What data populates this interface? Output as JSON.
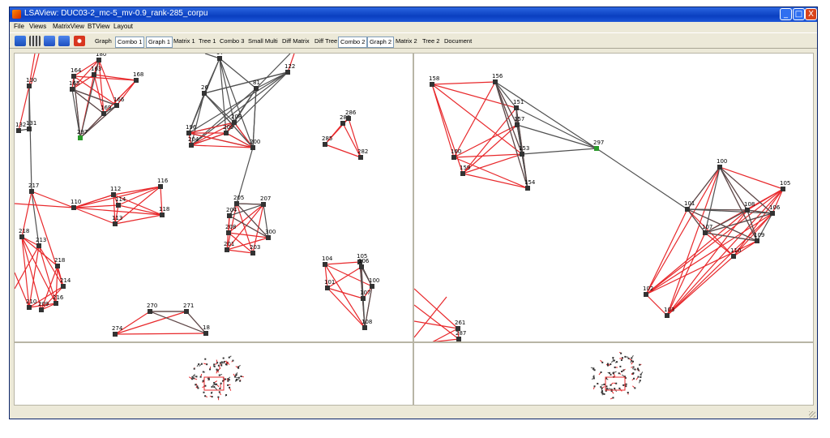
{
  "window": {
    "title": "LSAView: DUC03-2_mc-5_mv-0.9_rank-285_corpu",
    "controls": {
      "minimize": "_",
      "maximize": "□",
      "close": "X"
    }
  },
  "menu": [
    "File",
    "Views",
    "MatrixView",
    "BTView",
    "Layout"
  ],
  "toolbar": {
    "icons": [
      "open-folder-icon",
      "grid-icon",
      "save-icon",
      "save-as-icon",
      "power-icon"
    ],
    "tabs": [
      "Graph",
      "Combo 1",
      "Graph 1",
      "Matrix 1",
      "Tree 1",
      "Combo 3",
      "Small Multi",
      "Diff Matrix",
      "Diff Tree",
      "Combo 2",
      "Graph 2",
      "Matrix 2",
      "Tree 2",
      "Document"
    ],
    "selected_tabs": [
      "Combo 1",
      "Graph 1",
      "Combo 2",
      "Graph 2"
    ]
  },
  "colors": {
    "edge_red": "#e8282b",
    "edge_gray": "#505050",
    "node": "#333333",
    "node_highlight": "#2a9a2a"
  },
  "graph_left": {
    "node_labels": [
      "180",
      "164",
      "163",
      "168",
      "165",
      "166",
      "169",
      "297",
      "130",
      "132",
      "131",
      "217",
      "110",
      "112",
      "114",
      "113",
      "116",
      "118",
      "218",
      "213",
      "218",
      "214",
      "216",
      "210",
      "209",
      "97",
      "26",
      "81",
      "122",
      "208",
      "196",
      "209",
      "204",
      "200",
      "205",
      "207",
      "204",
      "208",
      "201",
      "203",
      "300",
      "283",
      "286",
      "285",
      "282",
      "105",
      "106",
      "104",
      "101",
      "100",
      "107",
      "108",
      "270",
      "271",
      "274",
      "18"
    ]
  },
  "graph_right": {
    "node_labels": [
      "158",
      "156",
      "151",
      "157",
      "153",
      "160",
      "159",
      "154",
      "297",
      "100",
      "105",
      "101",
      "107",
      "108",
      "106",
      "109",
      "110",
      "102",
      "103",
      "261",
      "287"
    ]
  }
}
